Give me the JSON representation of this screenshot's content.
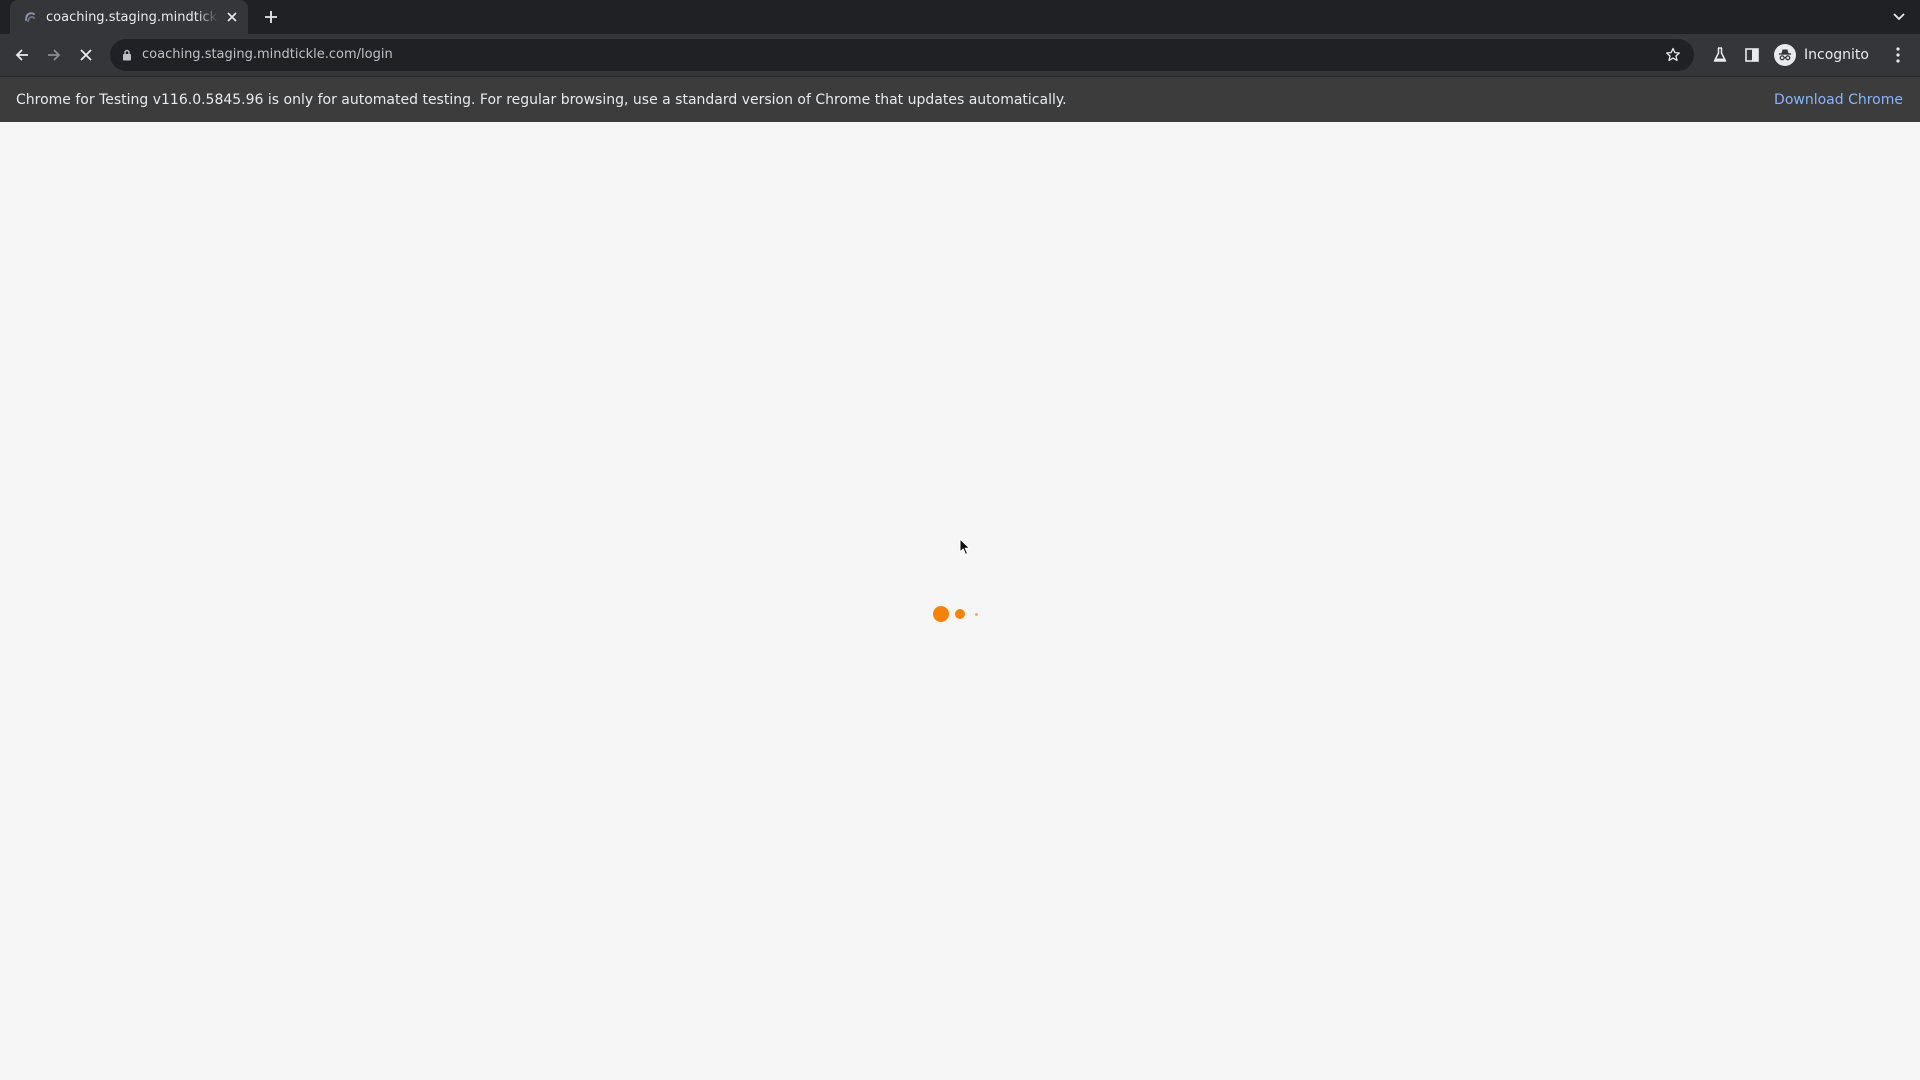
{
  "tabstrip": {
    "active_tab": {
      "title": "coaching.staging.mindtickle.com/login"
    }
  },
  "toolbar": {
    "url": "coaching.staging.mindtickle.com/login",
    "profile_label": "Incognito"
  },
  "infobar": {
    "message": "Chrome for Testing v116.0.5845.96 is only for automated testing. For regular browsing, use a standard version of Chrome that updates automatically.",
    "link_label": "Download Chrome"
  },
  "colors": {
    "tabstrip_bg": "#202124",
    "toolbar_bg": "#35363a",
    "infobar_bg": "#3c3c3c",
    "page_bg": "#f6f6f6",
    "link": "#8ab4f8",
    "loader_dot": "#f5820b"
  },
  "icons": {
    "tab_favicon": "mindtickle-favicon-icon",
    "tab_close": "close-icon",
    "new_tab": "plus-icon",
    "tab_search": "chevron-down-icon",
    "back": "arrow-left-icon",
    "forward": "arrow-right-icon",
    "stop": "close-icon",
    "lock": "lock-icon",
    "bookmark": "star-icon",
    "labs": "flask-icon",
    "side_panel": "side-panel-icon",
    "incognito": "incognito-icon",
    "menu": "kebab-menu-icon"
  }
}
